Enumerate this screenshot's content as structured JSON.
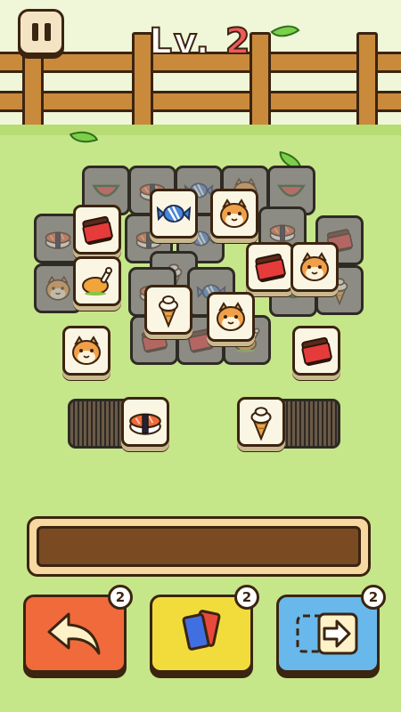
{
  "header": {
    "level_prefix": "Lv.",
    "level_number": "2"
  },
  "board": {
    "front_tiles": [
      {
        "icon": "chocolate-icon"
      },
      {
        "icon": "candy-icon"
      },
      {
        "icon": "hamster-icon"
      },
      {
        "icon": "roast-chicken-icon"
      },
      {
        "icon": "chocolate-icon"
      },
      {
        "icon": "hamster-icon"
      },
      {
        "icon": "ice-cream-icon"
      },
      {
        "icon": "hamster-icon"
      },
      {
        "icon": "hamster-icon"
      },
      {
        "icon": "chocolate-icon"
      }
    ],
    "left_stack_top": {
      "icon": "sushi-icon"
    },
    "right_stack_top": {
      "icon": "ice-cream-icon"
    }
  },
  "tools": {
    "undo": {
      "count": "2",
      "icon": "undo-arrow-icon"
    },
    "shuffle": {
      "count": "2",
      "icon": "cards-icon"
    },
    "move_out": {
      "count": "2",
      "icon": "move-out-icon"
    }
  },
  "colors": {
    "undo": "#f06a3c",
    "shuffle": "#f2dc3c",
    "move_out": "#68b8ec",
    "tray": "#7a4a22"
  }
}
